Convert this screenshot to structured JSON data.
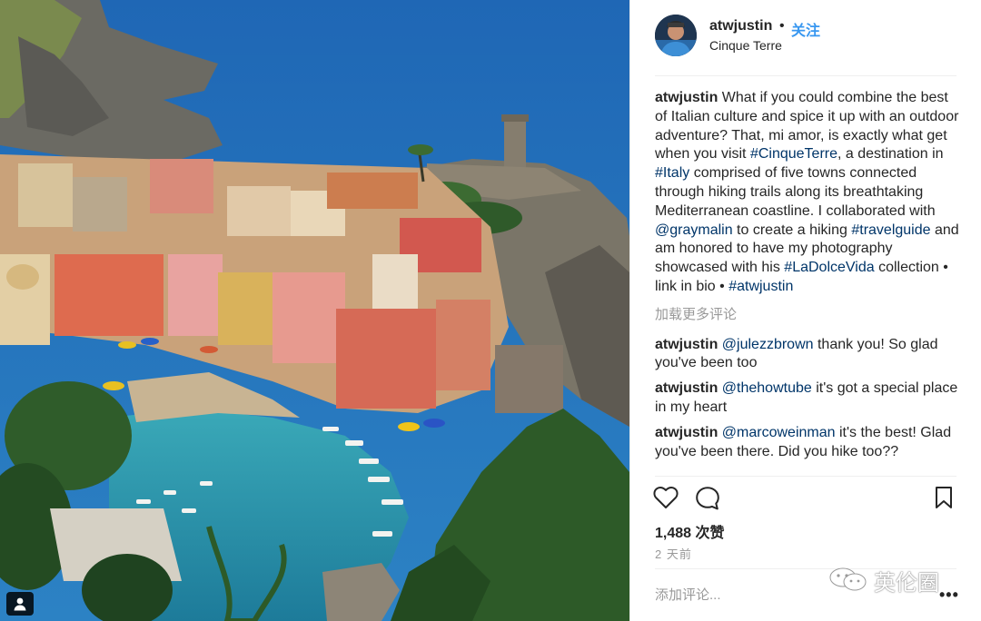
{
  "post": {
    "username": "atwjustin",
    "separator": "•",
    "follow_label": "关注",
    "location": "Cinque Terre"
  },
  "caption": {
    "user": "atwjustin",
    "parts": [
      " What if you could combine the best of Italian culture and spice it up with an outdoor adventure? That, mi amor, is exactly what get when you visit ",
      "#CinqueTerre",
      ", a destination in ",
      "#Italy",
      " comprised of five towns connected through hiking trails along its breathtaking Mediterranean coastline. I collaborated with ",
      "@graymalin",
      " to create a hiking ",
      "#travelguide",
      " and am honored to have my photography showcased with his ",
      "#LaDolceVida",
      " collection • link in bio • ",
      "#atwjustin"
    ]
  },
  "load_more": "加载更多评论",
  "comments": [
    {
      "user": "atwjustin",
      "mention": "@julezzbrown",
      "text": " thank you! So glad you've been too"
    },
    {
      "user": "atwjustin",
      "mention": "@thehowtube",
      "text": " it's got a special place in my heart"
    },
    {
      "user": "atwjustin",
      "mention": "@marcoweinman",
      "text": " it's the best! Glad you've been there. Did you hike too??"
    }
  ],
  "actions": {
    "like_icon": "heart-icon",
    "comment_icon": "comment-bubble-icon",
    "save_icon": "bookmark-icon"
  },
  "likes": "1,488 次赞",
  "time": "2 天前",
  "add_comment_placeholder": "添加评论...",
  "more_label": "•••",
  "watermark": "英伦圈",
  "colors": {
    "link": "#003569",
    "follow": "#3897f0",
    "muted": "#999999"
  }
}
